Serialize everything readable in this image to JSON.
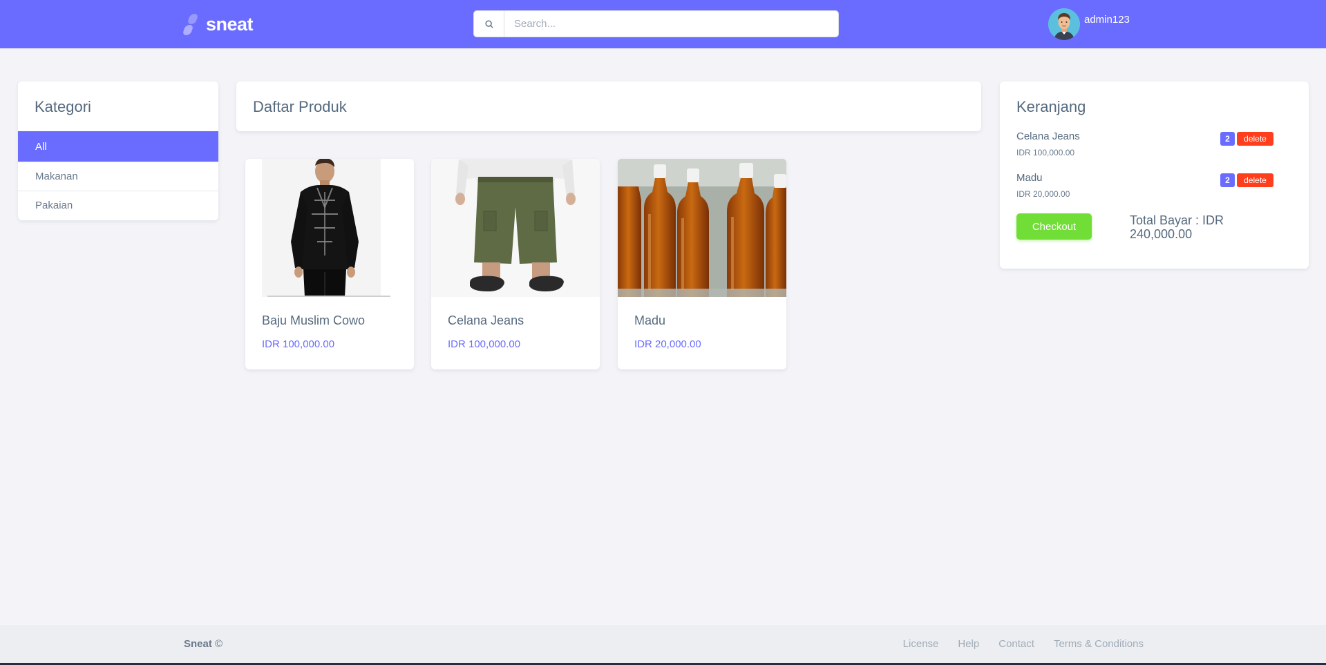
{
  "brand": {
    "name": "sneat"
  },
  "search": {
    "placeholder": "Search..."
  },
  "user": {
    "name": "admin123"
  },
  "kategori": {
    "title": "Kategori",
    "items": [
      {
        "label": "All",
        "active": true
      },
      {
        "label": "Makanan",
        "active": false
      },
      {
        "label": "Pakaian",
        "active": false
      }
    ]
  },
  "produk": {
    "title": "Daftar Produk",
    "items": [
      {
        "name": "Baju Muslim Cowo",
        "price": "IDR 100,000.00",
        "image": "black-muslim-shirt"
      },
      {
        "name": "Celana Jeans",
        "price": "IDR 100,000.00",
        "image": "green-pants"
      },
      {
        "name": "Madu",
        "price": "IDR 20,000.00",
        "image": "honey-bottles"
      }
    ]
  },
  "keranjang": {
    "title": "Keranjang",
    "items": [
      {
        "name": "Celana Jeans",
        "price": "IDR 100,000.00",
        "qty": "2",
        "delete_label": "delete"
      },
      {
        "name": "Madu",
        "price": "IDR 20,000.00",
        "qty": "2",
        "delete_label": "delete"
      }
    ],
    "checkout_label": "Checkout",
    "total_label": "Total Bayar : IDR 240,000.00"
  },
  "footer": {
    "brand": "Sneat",
    "copyright": "©",
    "links": [
      "License",
      "Help",
      "Contact",
      "Terms & Conditions"
    ]
  },
  "colors": {
    "primary": "#696cff",
    "navbar": "#6a6cff",
    "success": "#71dd37",
    "danger": "#ff3e1d",
    "background": "#f4f4f8"
  }
}
